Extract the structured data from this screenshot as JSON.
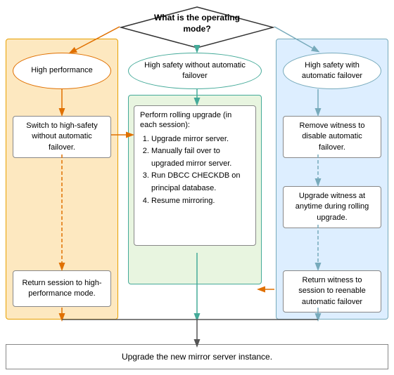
{
  "diagram": {
    "title": "What is the operating mode?",
    "col_left": {
      "oval_label": "High performance",
      "box1_label": "Switch to high-safety without automatic failover.",
      "box2_label": "Return session to high-performance mode."
    },
    "col_mid": {
      "oval_label": "High safety without automatic failover",
      "list_title": "Perform rolling upgrade (in each session):",
      "list_items": [
        "Upgrade mirror server.",
        "Manually fail over to upgraded mirror server.",
        "Run DBCC CHECKDB on principal database.",
        "Resume mirroring."
      ]
    },
    "col_right": {
      "oval_label": "High safety with automatic failover",
      "box1_label": "Remove witness to disable automatic failover.",
      "box2_label": "Upgrade witness at anytime during rolling upgrade.",
      "box3_label": "Return witness to session to reenable automatic failover"
    },
    "bottom_label": "Upgrade the new mirror server instance."
  }
}
